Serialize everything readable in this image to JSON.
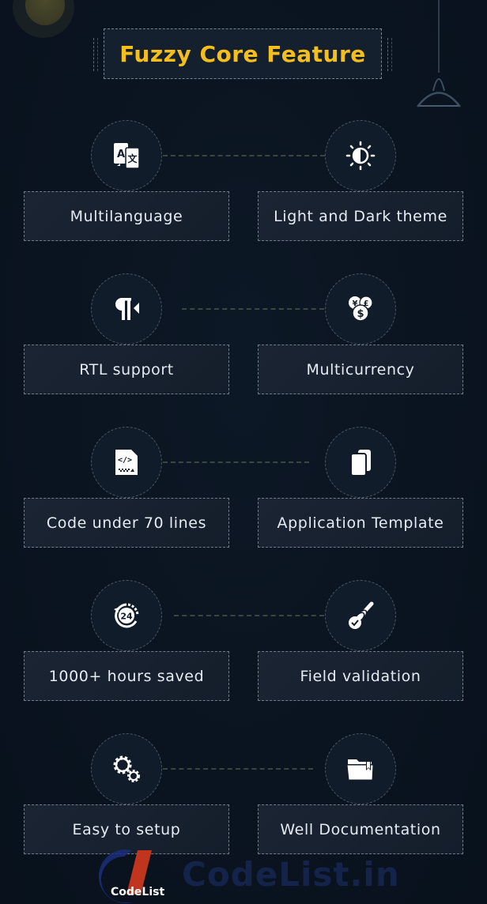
{
  "header": {
    "title": "Fuzzy Core Feature",
    "title_color": "#f5be1b"
  },
  "features": [
    {
      "left": {
        "label": "Multilanguage",
        "icon": "translate-icon"
      },
      "right": {
        "label": "Light and Dark theme",
        "icon": "contrast-sun-icon"
      }
    },
    {
      "left": {
        "label": "RTL support",
        "icon": "rtl-paragraph-icon"
      },
      "right": {
        "label": "Multicurrency",
        "icon": "currency-coins-icon"
      }
    },
    {
      "left": {
        "label": "Code under 70 lines",
        "icon": "code-file-icon"
      },
      "right": {
        "label": "Application Template",
        "icon": "copy-pages-icon"
      }
    },
    {
      "left": {
        "label": "1000+ hours saved",
        "icon": "24-hours-icon"
      },
      "right": {
        "label": "Field validation",
        "icon": "validation-brush-icon"
      }
    },
    {
      "left": {
        "label": "Easy to setup",
        "icon": "gears-icon"
      },
      "right": {
        "label": "Well Documentation",
        "icon": "bookmark-folder-icon"
      }
    }
  ],
  "watermark": {
    "logo_text": "CodeList",
    "site_text": "CodeList.in"
  }
}
